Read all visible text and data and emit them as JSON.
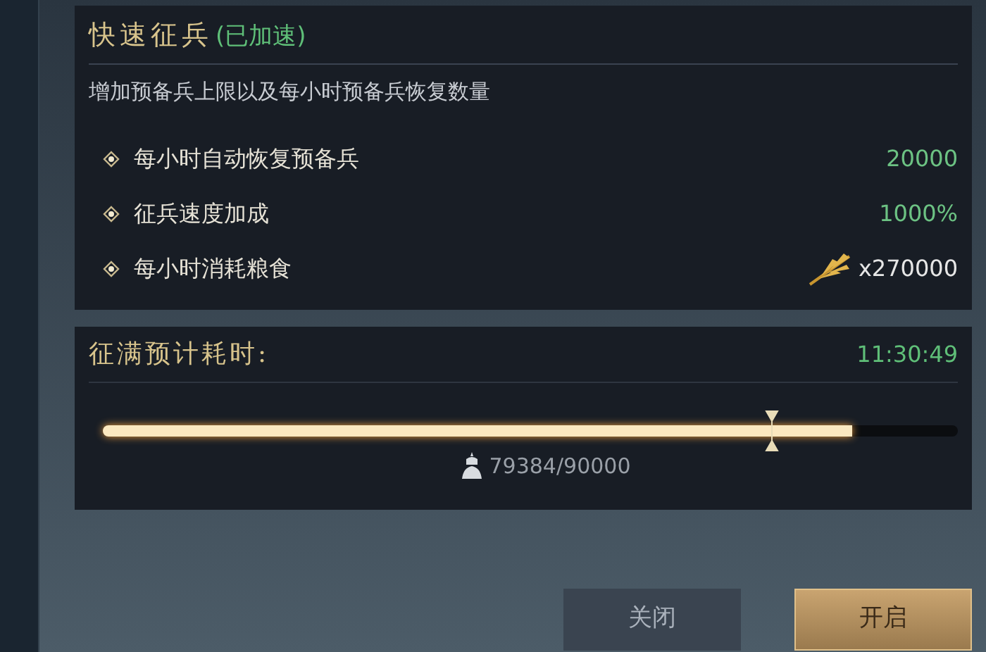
{
  "title": "快速征兵",
  "status": "(已加速)",
  "description": "增加预备兵上限以及每小时预备兵恢复数量",
  "stats": [
    {
      "label": "每小时自动恢复预备兵",
      "value": "20000",
      "kind": "plain"
    },
    {
      "label": "征兵速度加成",
      "value": "1000%",
      "kind": "plain"
    },
    {
      "label": "每小时消耗粮食",
      "value": "x270000",
      "kind": "cost"
    }
  ],
  "timer": {
    "label": "征满预计耗时:",
    "value": "11:30:49"
  },
  "progress": {
    "level": 0.876,
    "reading": "79384/90000"
  },
  "buttons": [
    {
      "label": "关闭",
      "kind": "secondary"
    },
    {
      "label": "开启",
      "kind": "primary"
    }
  ]
}
